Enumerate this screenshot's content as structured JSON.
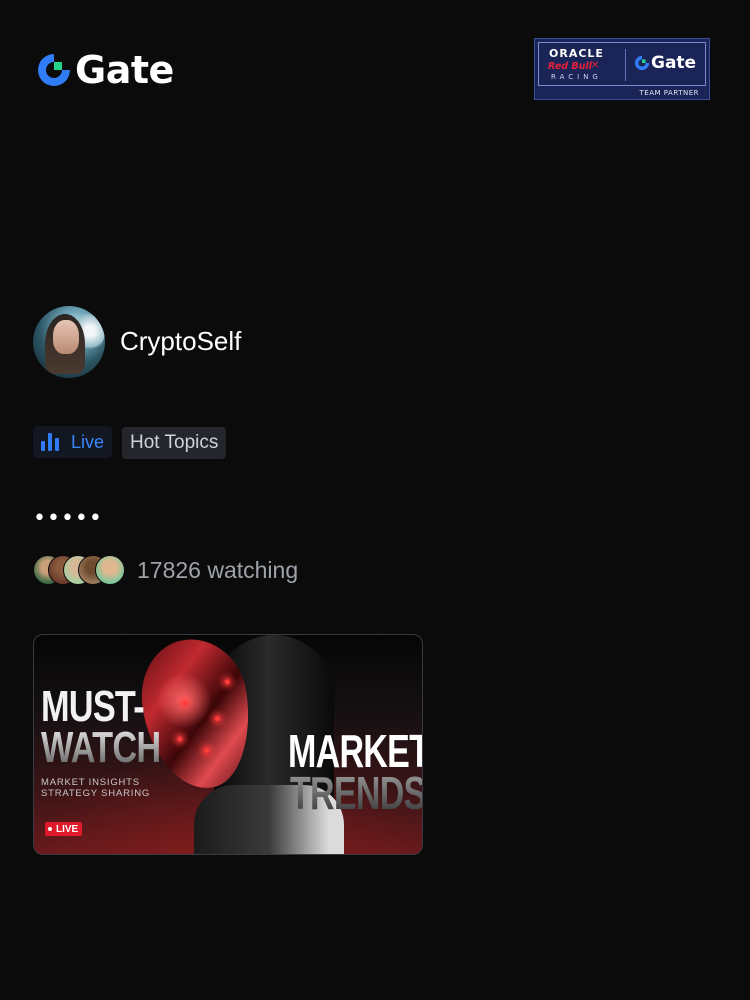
{
  "header": {
    "brand_name": "Gate",
    "brand_color": "#2f7cf6",
    "partner_badge": {
      "line1": "ORACLE",
      "line2": "Red Bull",
      "line3": "RACING",
      "gate": "Gate",
      "caption": "TEAM PARTNER"
    }
  },
  "profile": {
    "username": "CryptoSelf"
  },
  "tags": {
    "live_label": "Live",
    "topic_label": "Hot Topics"
  },
  "status_dots": "•••••",
  "watchers": {
    "text": "17826 watching"
  },
  "stream_card": {
    "title_line1": "MUST-",
    "title_line2": "WATCH",
    "title_line3": "MARKET",
    "title_line4": "TRENDS",
    "subline1": "MARKET INSIGHTS",
    "subline2": "STRATEGY SHARING",
    "live_badge": "LIVE"
  },
  "colors": {
    "accent": "#3a86ff",
    "background": "#0b0b0c",
    "live_red": "#e0192b"
  }
}
